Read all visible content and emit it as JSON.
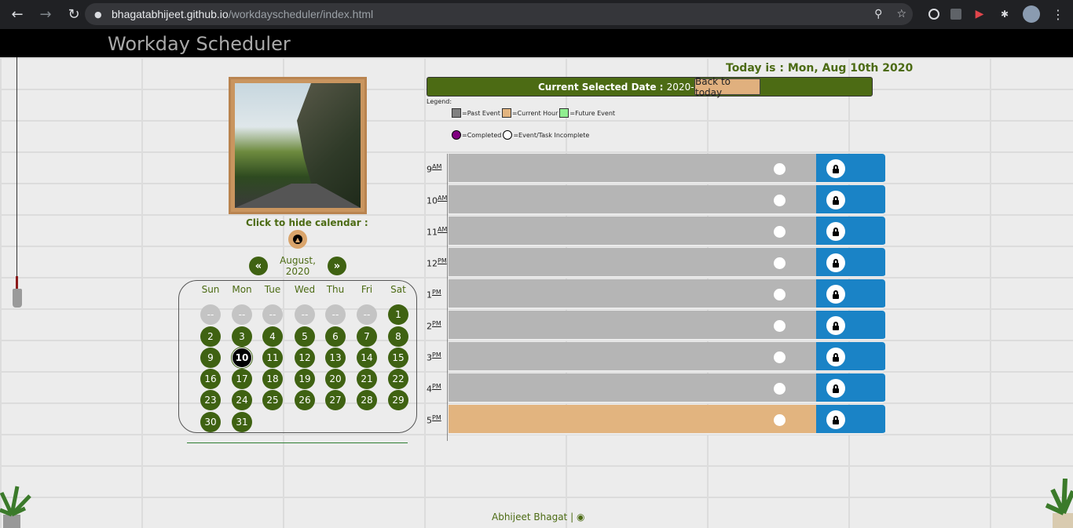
{
  "browser": {
    "url_host": "bhagatabhijeet.github.io",
    "url_path": "/workdayscheduler/index.html"
  },
  "site": {
    "title": "Workday Scheduler",
    "today_label": "Today is : Mon, Aug 10th 2020"
  },
  "calendar": {
    "toggle_label": "Click to hide calendar :",
    "month_label": "August, 2020",
    "prev_glyph": "«",
    "next_glyph": "»",
    "weekdays": [
      "Sun",
      "Mon",
      "Tue",
      "Wed",
      "Thu",
      "Fri",
      "Sat"
    ],
    "placeholder": "--",
    "leading_blanks": 6,
    "days_in_month": 31,
    "selected_day": 10
  },
  "selected_date": {
    "label": "Current Selected Date : ",
    "value": "2020-8-10",
    "back_button": "Back to today"
  },
  "legend": {
    "title": "Legend:",
    "past": "=Past Event",
    "current": "=Current Hour",
    "future": "=Future Event",
    "completed": "=Completed",
    "incomplete": "=Event/Task Incomplete",
    "colors": {
      "past": "#808080",
      "current": "#e2b47f",
      "future": "#90ee90",
      "completed": "#800080"
    }
  },
  "schedule": [
    {
      "hour": "9",
      "ampm": "AM",
      "state": "past"
    },
    {
      "hour": "10",
      "ampm": "AM",
      "state": "past"
    },
    {
      "hour": "11",
      "ampm": "AM",
      "state": "past"
    },
    {
      "hour": "12",
      "ampm": "PM",
      "state": "past"
    },
    {
      "hour": "1",
      "ampm": "PM",
      "state": "past"
    },
    {
      "hour": "2",
      "ampm": "PM",
      "state": "past"
    },
    {
      "hour": "3",
      "ampm": "PM",
      "state": "past"
    },
    {
      "hour": "4",
      "ampm": "PM",
      "state": "past"
    },
    {
      "hour": "5",
      "ampm": "PM",
      "state": "current"
    }
  ],
  "footer": {
    "author": "Abhijeet Bhagat |"
  },
  "colors": {
    "accent": "#3f6212",
    "save": "#1a83c6"
  }
}
